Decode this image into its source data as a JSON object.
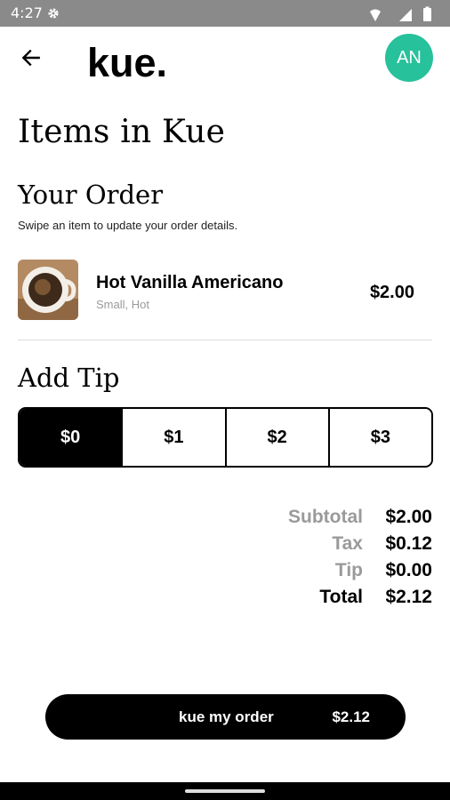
{
  "status_bar": {
    "time": "4:27"
  },
  "header": {
    "brand": "kue.",
    "avatar_initials": "AN"
  },
  "page_title": "Items in Kue",
  "order": {
    "heading": "Your Order",
    "hint": "Swipe an item to update your order details.",
    "items": [
      {
        "name": "Hot Vanilla Americano",
        "options": "Small, Hot",
        "price": "$2.00"
      }
    ]
  },
  "tip": {
    "heading": "Add Tip",
    "options": [
      "$0",
      "$1",
      "$2",
      "$3"
    ],
    "selected": "$0"
  },
  "summary": {
    "subtotal_label": "Subtotal",
    "subtotal_value": "$2.00",
    "tax_label": "Tax",
    "tax_value": "$0.12",
    "tip_label": "Tip",
    "tip_value": "$0.00",
    "total_label": "Total",
    "total_value": "$2.12"
  },
  "cta": {
    "label": "kue my order",
    "amount": "$2.12"
  },
  "colors": {
    "accent": "#27c19b",
    "status_bar": "#8a8a8a",
    "muted_text": "#9a9a9a",
    "primary": "#000000"
  },
  "icons": {
    "back": "arrow-left-icon",
    "settings": "gear-icon",
    "wifi": "wifi-icon",
    "signal": "signal-icon",
    "battery": "battery-icon"
  }
}
